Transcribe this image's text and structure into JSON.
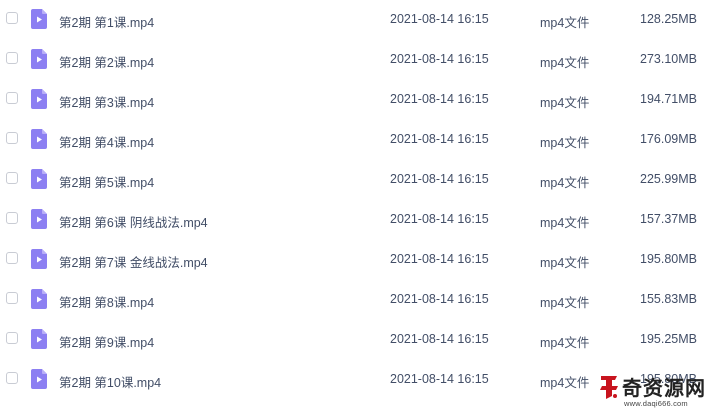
{
  "files": [
    {
      "name": "第2期 第1课.mp4",
      "date": "2021-08-14 16:15",
      "type": "mp4文件",
      "size": "128.25MB",
      "icon": "video-file-icon"
    },
    {
      "name": "第2期 第2课.mp4",
      "date": "2021-08-14 16:15",
      "type": "mp4文件",
      "size": "273.10MB",
      "icon": "video-file-icon"
    },
    {
      "name": "第2期 第3课.mp4",
      "date": "2021-08-14 16:15",
      "type": "mp4文件",
      "size": "194.71MB",
      "icon": "video-file-icon"
    },
    {
      "name": "第2期 第4课.mp4",
      "date": "2021-08-14 16:15",
      "type": "mp4文件",
      "size": "176.09MB",
      "icon": "video-file-icon"
    },
    {
      "name": "第2期 第5课.mp4",
      "date": "2021-08-14 16:15",
      "type": "mp4文件",
      "size": "225.99MB",
      "icon": "video-file-icon"
    },
    {
      "name": "第2期 第6课 阴线战法.mp4",
      "date": "2021-08-14 16:15",
      "type": "mp4文件",
      "size": "157.37MB",
      "icon": "video-file-icon"
    },
    {
      "name": "第2期 第7课 金线战法.mp4",
      "date": "2021-08-14 16:15",
      "type": "mp4文件",
      "size": "195.80MB",
      "icon": "video-file-icon"
    },
    {
      "name": "第2期 第8课.mp4",
      "date": "2021-08-14 16:15",
      "type": "mp4文件",
      "size": "155.83MB",
      "icon": "video-file-icon"
    },
    {
      "name": "第2期 第9课.mp4",
      "date": "2021-08-14 16:15",
      "type": "mp4文件",
      "size": "195.25MB",
      "icon": "video-file-icon"
    },
    {
      "name": "第2期 第10课.mp4",
      "date": "2021-08-14 16:15",
      "type": "mp4文件",
      "size": "195.80MB",
      "icon": "video-file-icon"
    }
  ],
  "watermark": {
    "title": "奇资源网",
    "url": "www.daqi666.com"
  },
  "colors": {
    "text": "#424e67",
    "icon": "#8c7ff2",
    "checkbox_border": "#c9ccd4",
    "watermark_red": "#c8141e"
  }
}
